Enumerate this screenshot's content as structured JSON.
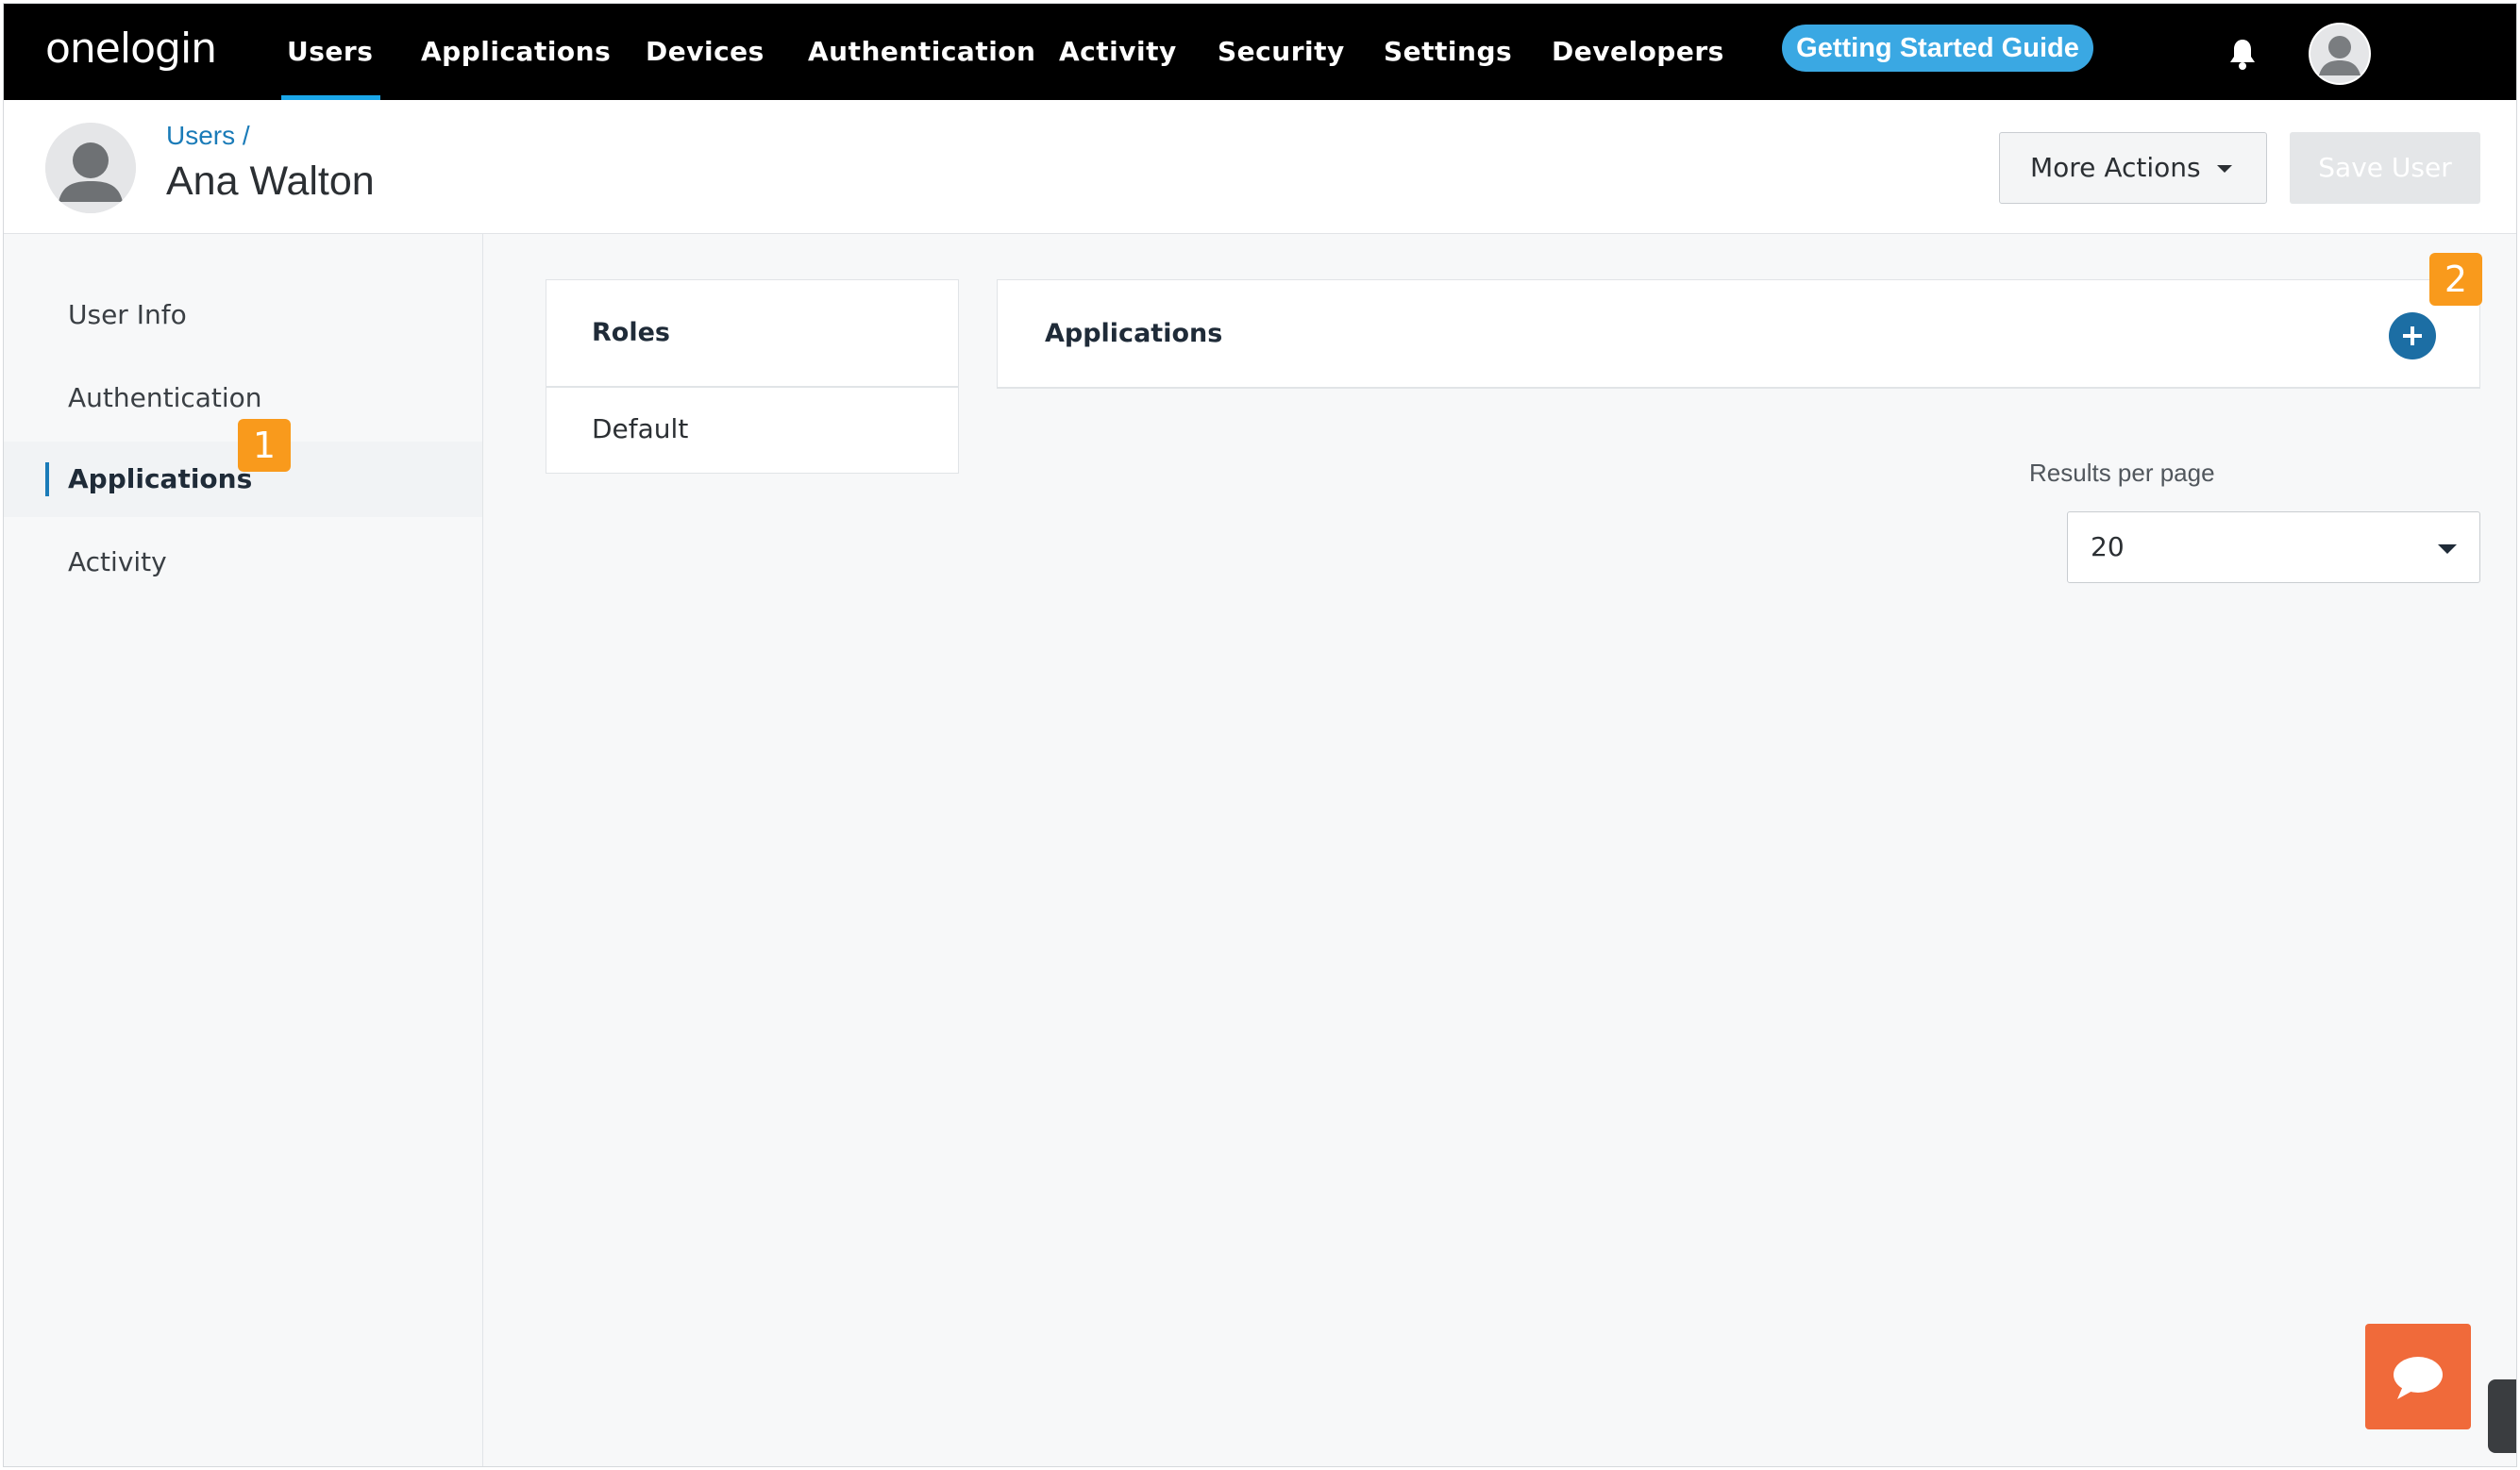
{
  "brand": {
    "logo": "onelogin"
  },
  "nav": {
    "items": [
      {
        "label": "Users",
        "active": true
      },
      {
        "label": "Applications"
      },
      {
        "label": "Devices"
      },
      {
        "label": "Authentication"
      },
      {
        "label": "Activity"
      },
      {
        "label": "Security"
      },
      {
        "label": "Settings"
      },
      {
        "label": "Developers"
      }
    ],
    "guide_label": "Getting Started Guide",
    "notifications_icon": "bell-icon",
    "profile_icon": "user-avatar-icon"
  },
  "header": {
    "breadcrumb": "Users /",
    "title": "Ana Walton",
    "more_actions_label": "More Actions",
    "save_label": "Save User"
  },
  "sidebar": {
    "items": [
      {
        "label": "User Info"
      },
      {
        "label": "Authentication"
      },
      {
        "label": "Applications",
        "active": true
      },
      {
        "label": "Activity"
      }
    ]
  },
  "annotations": {
    "first": "1",
    "second": "2"
  },
  "roles": {
    "title": "Roles",
    "items": [
      "Default"
    ]
  },
  "applications": {
    "title": "Applications",
    "add_icon": "plus-circle-icon",
    "results_per_page_label": "Results per page",
    "results_per_page_value": "20"
  },
  "widgets": {
    "chat_icon": "chat-bubble-icon"
  },
  "colors": {
    "nav_bg": "#000000",
    "accent": "#1aa6e8",
    "guide_button": "#3aa8e3",
    "annotation_badge": "#f99a1c",
    "add_button": "#1c6ea4",
    "chat_button": "#f06a3a",
    "link": "#1a7bb8"
  }
}
